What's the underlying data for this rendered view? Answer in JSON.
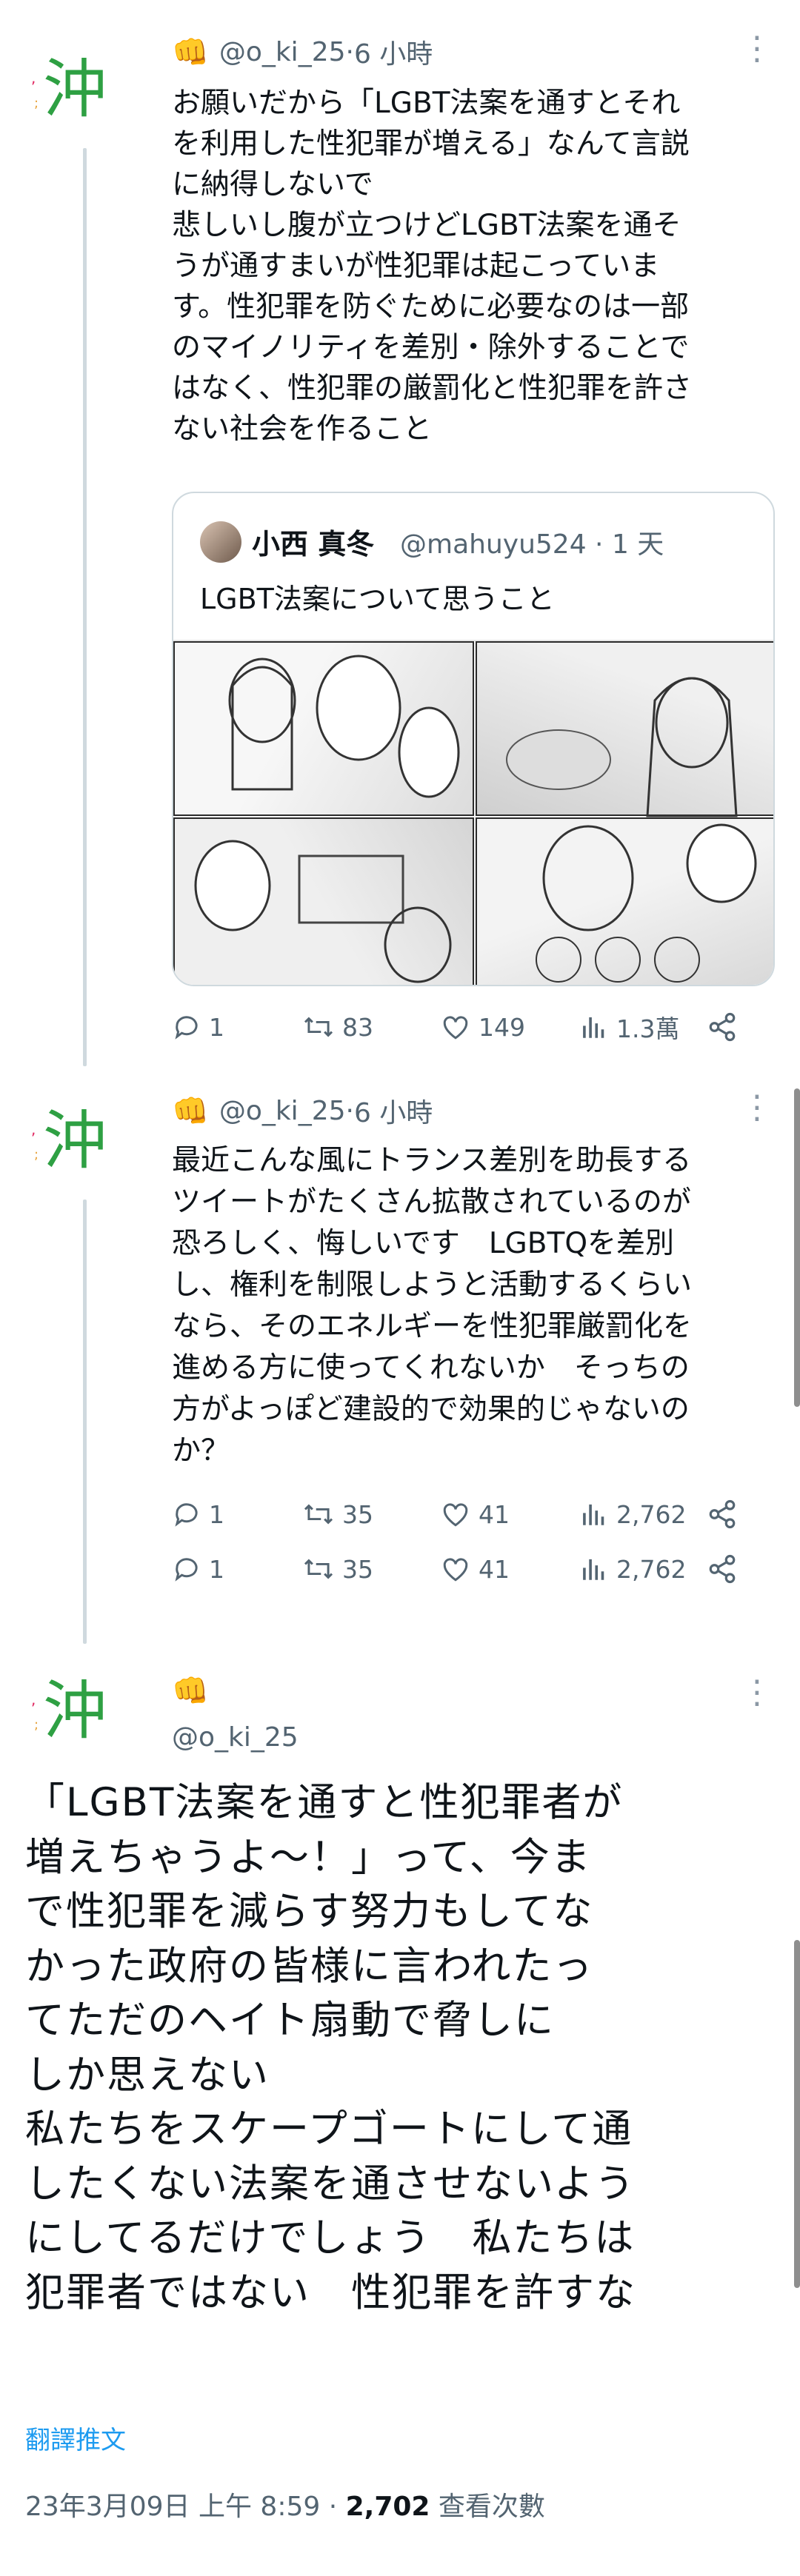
{
  "tweets": [
    {
      "handle": "@o_ki_25",
      "sep": " · ",
      "time": "6 小時",
      "text": "お願いだから「LGBT法案を通すとそれ\nを利用した性犯罪が増える」なんて言説\nに納得しないで\n悲しいし腹が立つけどLGBT法案を通そ\nうが通すまいが性犯罪は起こっていま\nす。性犯罪を防ぐために必要なのは一部\nのマイノリティを差別・除外することで\nはなく、性犯罪の厳罰化と性犯罪を許さ\nない社会を作ること",
      "quote": {
        "name": "小西 真冬",
        "handle": "@mahuyu524",
        "sep": " · ",
        "time": "1 天",
        "text": "LGBT法案について思うこと"
      },
      "stats": {
        "replies": "1",
        "retweets": "83",
        "likes": "149",
        "views": "1.3萬"
      }
    },
    {
      "handle": "@o_ki_25",
      "sep": " · ",
      "time": "6 小時",
      "text": "最近こんな風にトランス差別を助長する\nツイートがたくさん拡散されているのが\n恐ろしく、悔しいです　LGBTQを差別\nし、権利を制限しようと活動するくらい\nなら、そのエネルギーを性犯罪厳罰化を\n進める方に使ってくれないか　そっちの\n方がよっぽど建設的で効果的じゃないの\nか？",
      "stats": {
        "replies": "1",
        "retweets": "35",
        "likes": "41",
        "views": "2,762"
      },
      "stats_dup": {
        "replies": "1",
        "retweets": "35",
        "likes": "41",
        "views": "2,762"
      }
    }
  ],
  "main": {
    "handle": "@o_ki_25",
    "text": "「LGBT法案を通すと性犯罪者が\n増えちゃうよ〜！」って、今ま\nで性犯罪を減らす努力もしてな\nかった政府の皆様に言われたっ\nてただのヘイト扇動で脅しに\nしか思えない\n私たちをスケープゴートにして通\nしたくない法案を通させないよう\nにしてるだけでしょう　私たちは\n犯罪者ではない　性犯罪を許すな",
    "translate": "翻譯推文",
    "timestamp": "23年3月09日 上午 8:59 · ",
    "views_count": "2,702",
    "views_label": " 查看次數"
  },
  "avatar": {
    "char": "沖",
    "color": "#2ea043",
    "accent": "#e0245e"
  },
  "colors": {
    "link": "#1d9bf0",
    "muted": "#536471",
    "line": "#cfd9de"
  }
}
